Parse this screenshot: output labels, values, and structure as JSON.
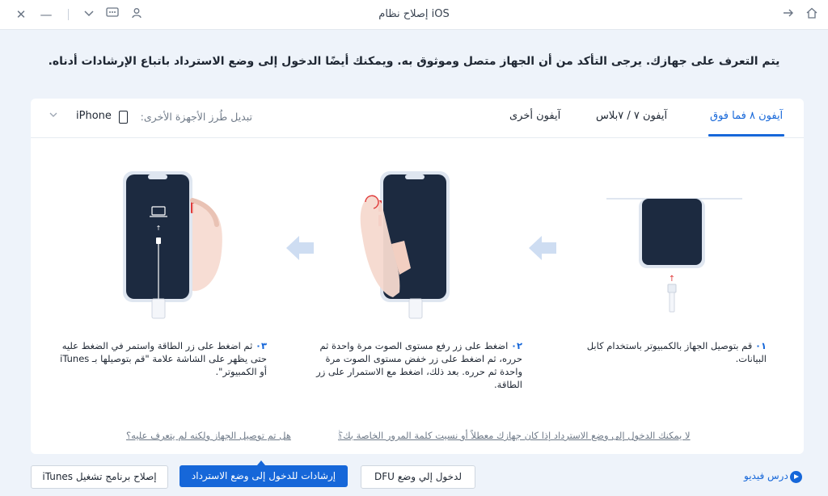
{
  "window": {
    "title": "إصلاح نظام iOS"
  },
  "headline": "يتم التعرف على جهازك. يرجى التأكد من أن الجهاز متصل وموثوق به. ويمكنك أيضًا الدخول إلى وضع الاسترداد باتباع الإرشادات أدناه.",
  "tabs": [
    {
      "label": "آيفون ٨ فما فوق",
      "active": true
    },
    {
      "label": "آيفون ٧ / ٧بلاس",
      "active": false
    },
    {
      "label": "آيفون أخرى",
      "active": false
    }
  ],
  "device_selector": {
    "switch_label": "تبديل طُرز الأجهزة الأخرى:",
    "device": "iPhone"
  },
  "steps": [
    {
      "num": "٠١",
      "text": "قم بتوصيل الجهاز بالكمبيوتر باستخدام كابل البيانات."
    },
    {
      "num": "٠٢",
      "text": "اضغط على زر رفع مستوى الصوت مرة واحدة ثم حرره، ثم اضغط على زر خفض مستوى الصوت مرة واحدة ثم حرره. بعد ذلك، اضغط مع الاستمرار على زر الطاقة."
    },
    {
      "num": "٠٣",
      "text": "ثم اضغط على زر الطاقة واستمر في الضغط عليه حتى يظهر على الشاشة علامة \"قم بتوصيلها بـ iTunes أو الكمبيوتر\"."
    }
  ],
  "links": {
    "left": "هل تم توصيل الجهاز ولكنه لم يتعرف عليه؟",
    "right": "لا يمكنك الدخول إلى وضع الاسترداد إذا كان جهازك معطلاً أو نسيت كلمة المرور الخاصة بك؟"
  },
  "buttons": {
    "itunes": "إصلاح برنامج تشغيل iTunes",
    "recovery": "إرشادات للدخول إلى وضع الاسترداد",
    "dfu": "لدخول إلي وضع DFU"
  },
  "video_tutorial": "درس فيديو",
  "colors": {
    "accent": "#1667d9",
    "background": "#eef3fa",
    "phone_screen": "#1c2a40",
    "button_highlight": "#e03a3a"
  }
}
